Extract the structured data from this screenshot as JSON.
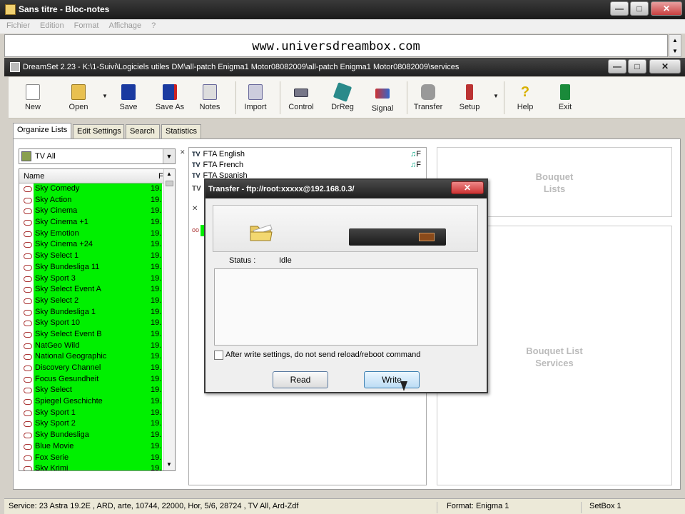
{
  "notepad": {
    "title": "Sans titre - Bloc-notes",
    "menu": [
      "Fichier",
      "Edition",
      "Format",
      "Affichage",
      "?"
    ],
    "text": "www.universdreambox.com",
    "buttons": {
      "minimize": "—",
      "maximize": "□",
      "close": "✕"
    }
  },
  "dreamset": {
    "title": "DreamSet 2.23 - K:\\1-Suivi\\Logiciels utiles DM\\all-patch Enigma1 Motor08082009\\all-patch Enigma1 Motor08082009\\services",
    "toolbar": [
      "New",
      "Open",
      "Save",
      "Save As",
      "Notes",
      "Import",
      "Control",
      "DrReg",
      "Signal",
      "Transfer",
      "Setup",
      "Help",
      "Exit"
    ],
    "tabs": [
      "Organize Lists",
      "Edit Settings",
      "Search",
      "Statistics"
    ],
    "list_filter": "TV All",
    "list_headers": {
      "name": "Name",
      "freq": "F"
    },
    "channels": [
      {
        "name": "Sky Comedy",
        "freq": "19."
      },
      {
        "name": "Sky Action",
        "freq": "19."
      },
      {
        "name": "Sky Cinema",
        "freq": "19."
      },
      {
        "name": "Sky Cinema +1",
        "freq": "19."
      },
      {
        "name": "Sky Emotion",
        "freq": "19."
      },
      {
        "name": "Sky Cinema +24",
        "freq": "19."
      },
      {
        "name": "Sky Select 1",
        "freq": "19."
      },
      {
        "name": "Sky Bundesliga 11",
        "freq": "19."
      },
      {
        "name": "Sky Sport 3",
        "freq": "19."
      },
      {
        "name": "Sky Select Event A",
        "freq": "19."
      },
      {
        "name": "Sky Select 2",
        "freq": "19."
      },
      {
        "name": "Sky Bundesliga 1",
        "freq": "19."
      },
      {
        "name": "Sky Sport 10",
        "freq": "19."
      },
      {
        "name": "Sky Select Event B",
        "freq": "19."
      },
      {
        "name": "NatGeo Wild",
        "freq": "19."
      },
      {
        "name": "National Geographic",
        "freq": "19."
      },
      {
        "name": "Discovery Channel",
        "freq": "19."
      },
      {
        "name": "Focus Gesundheit",
        "freq": "19."
      },
      {
        "name": "Sky Select",
        "freq": "19."
      },
      {
        "name": "Spiegel Geschichte",
        "freq": "19."
      },
      {
        "name": "Sky Sport 1",
        "freq": "19."
      },
      {
        "name": "Sky Sport 2",
        "freq": "19."
      },
      {
        "name": "Sky Bundesliga",
        "freq": "19."
      },
      {
        "name": "Blue Movie",
        "freq": "19."
      },
      {
        "name": "Fox Serie",
        "freq": "19."
      },
      {
        "name": "Sky Krimi",
        "freq": "19."
      }
    ],
    "bouquets": [
      {
        "tag": "TV",
        "name": "FTA English",
        "flag": "F"
      },
      {
        "tag": "TV",
        "name": "FTA French",
        "flag": "F"
      },
      {
        "tag": "TV",
        "name": "FTA Spanish",
        "flag": ""
      }
    ],
    "bouquet_lists_label": [
      "Bouquet",
      "Lists"
    ],
    "bouquet_services_label": [
      "Bouquet List",
      "Services"
    ],
    "status": {
      "service": "Service: 23 Astra 19.2E , ARD, arte, 10744, 22000, Hor, 5/6, 28724 , TV All, Ard-Zdf",
      "format": "Format: Enigma 1",
      "box": "SetBox 1"
    }
  },
  "transfer_dialog": {
    "title": "Transfer - ftp://root:xxxxx@192.168.0.3/",
    "close": "✕",
    "status_label": "Status :",
    "status_value": "Idle",
    "checkbox_label": "After write settings, do not send reload/reboot command",
    "checkbox_checked": false,
    "read_label": "Read",
    "write_label": "Write"
  },
  "icon_names": [
    "notepad-icon",
    "dreamset-icon",
    "tv-icon",
    "folder-icon",
    "receiver-icon",
    "music-note-icon"
  ],
  "colors": {
    "highlight_green": "#00f000",
    "title_dark": "#222222"
  }
}
